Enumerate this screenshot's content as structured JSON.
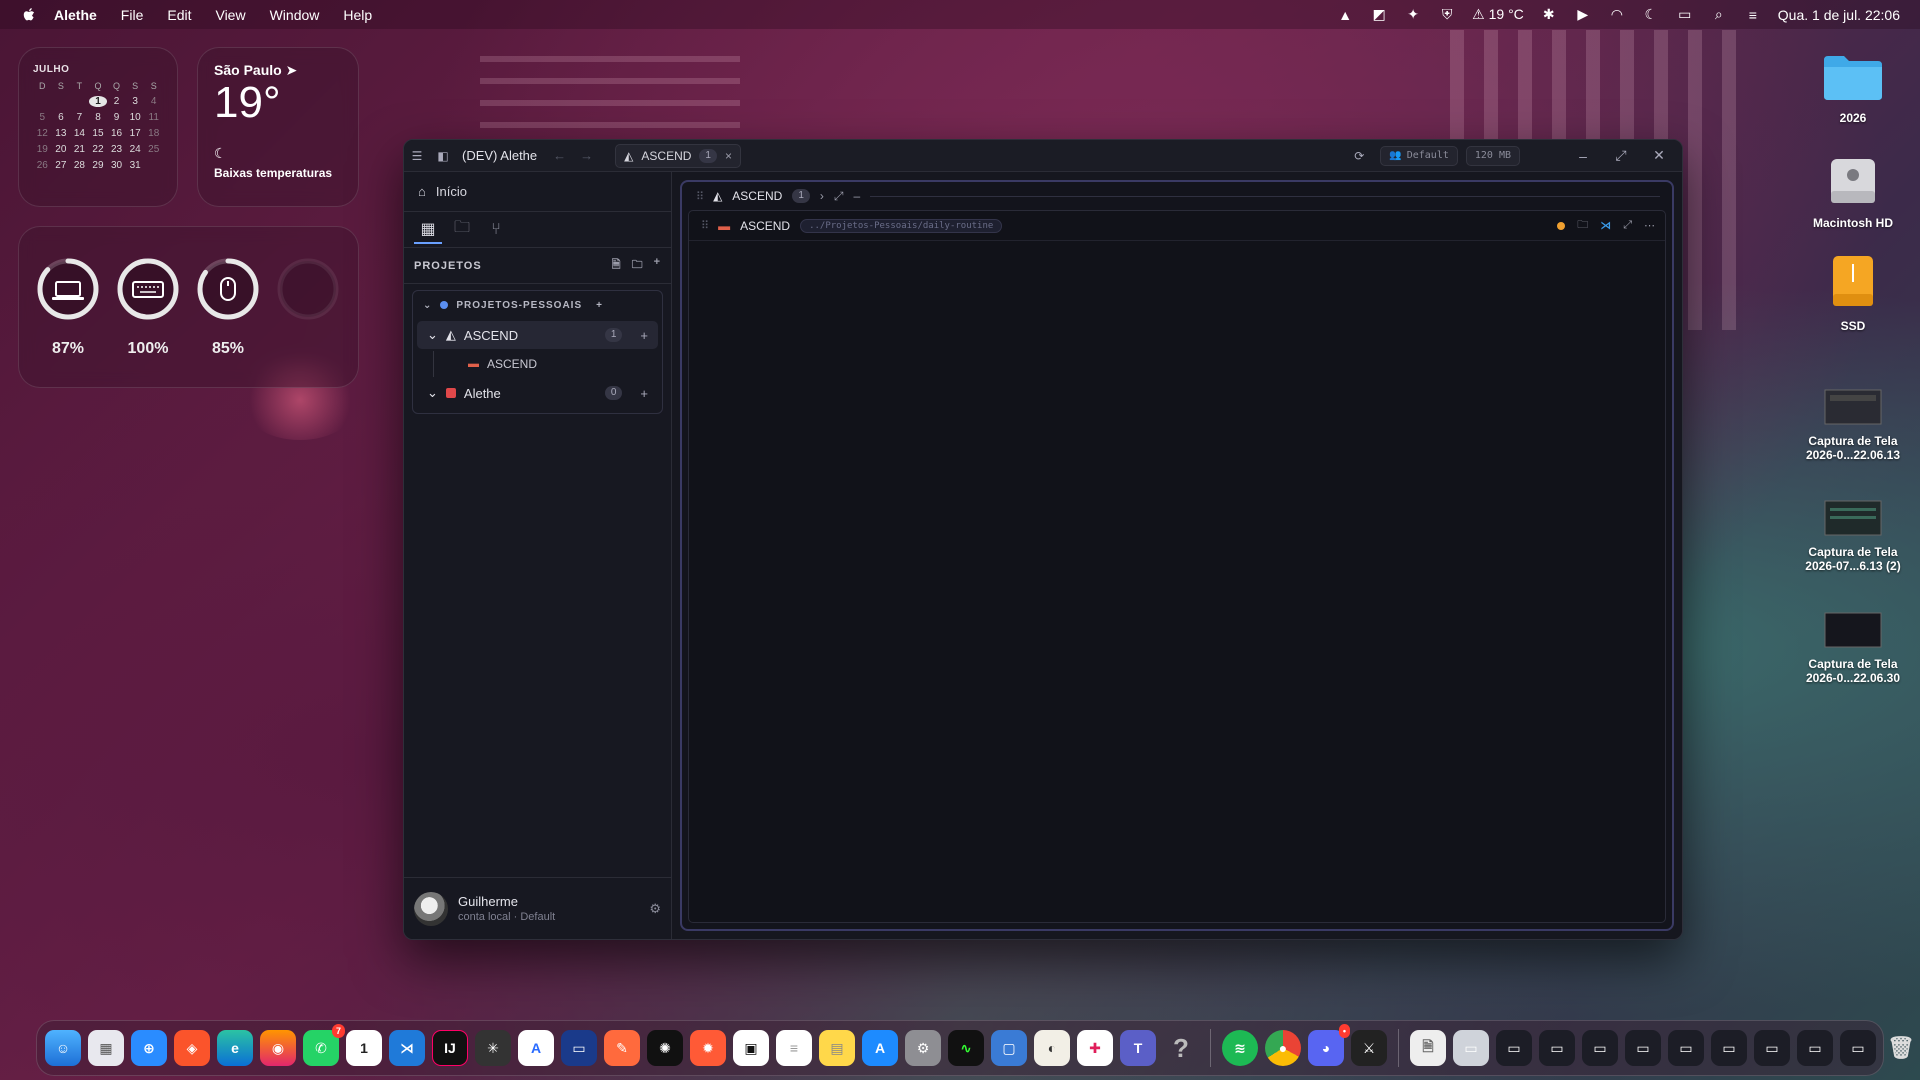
{
  "menubar": {
    "app_name": "Alethe",
    "items": [
      "File",
      "Edit",
      "View",
      "Window",
      "Help"
    ],
    "temperature": "19 °C",
    "datetime": "Qua. 1 de jul.  22:06"
  },
  "calendar": {
    "month": "JULHO",
    "weekdays": [
      "D",
      "S",
      "T",
      "Q",
      "Q",
      "S",
      "S"
    ],
    "rows": [
      [
        "",
        "",
        "",
        "1",
        "2",
        "3",
        "4"
      ],
      [
        "5",
        "6",
        "7",
        "8",
        "9",
        "10",
        "11"
      ],
      [
        "12",
        "13",
        "14",
        "15",
        "16",
        "17",
        "18"
      ],
      [
        "19",
        "20",
        "21",
        "22",
        "23",
        "24",
        "25"
      ],
      [
        "26",
        "27",
        "28",
        "29",
        "30",
        "31",
        ""
      ]
    ],
    "today": "1"
  },
  "weather": {
    "city": "São Paulo",
    "temp": "19°",
    "condition": "Baixas temperaturas"
  },
  "batteries": [
    {
      "device": "laptop-icon",
      "percent": "87%",
      "level": 0.87
    },
    {
      "device": "keyboard-icon",
      "percent": "100%",
      "level": 1.0
    },
    {
      "device": "mouse-icon",
      "percent": "85%",
      "level": 0.85
    }
  ],
  "desktop": {
    "folder_2026": "2026",
    "macintosh": "Macintosh HD",
    "ssd": "SSD",
    "shot1_line1": "Captura de Tela",
    "shot1_line2": "2026-0...22.06.13",
    "shot2_line1": "Captura de Tela",
    "shot2_line2": "2026-07...6.13 (2)",
    "shot3_line1": "Captura de Tela",
    "shot3_line2": "2026-0...22.06.30"
  },
  "window": {
    "title": "(DEV) Alethe",
    "tab_label": "ASCEND",
    "tab_count": "1",
    "profile": "Default",
    "memory": "120 MB"
  },
  "sidebar": {
    "home": "Início",
    "section": "PROJETOS",
    "group": "PROJETOS-PESSOAIS",
    "projects": [
      {
        "name": "ASCEND",
        "count": "1",
        "child": "ASCEND"
      },
      {
        "name": "Alethe",
        "count": "0"
      }
    ],
    "user_name": "Guilherme",
    "user_sub": "conta local · Default"
  },
  "main": {
    "panel_title": "ASCEND",
    "panel_count": "1",
    "terminal_name": "ASCEND",
    "terminal_path": "../Projetos-Pessoais/daily-routine"
  },
  "colors": {
    "accent": "#6aa0ff",
    "group_dot": "#5b8ff0",
    "alethe": "#e0484a",
    "ascend_sub": "#e0604a"
  }
}
